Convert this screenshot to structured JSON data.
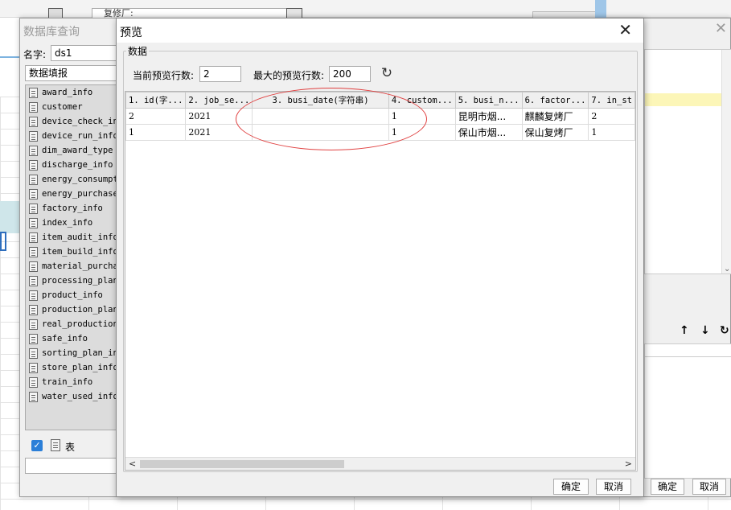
{
  "background": {
    "field_text": "复修厂:"
  },
  "db_dialog": {
    "title": "数据库查询",
    "name_label": "名字:",
    "name_value": "ds1",
    "combo_value": "数据填报",
    "tables": [
      "award_info",
      "customer",
      "device_check_info",
      "device_run_info",
      "dim_award_type",
      "discharge_info",
      "energy_consumption",
      "energy_purchase_",
      "factory_info",
      "index_info",
      "item_audit_info",
      "item_build_info",
      "material_purchase",
      "processing_plan_",
      "product_info",
      "production_plan_",
      "real_production_",
      "safe_info",
      "sorting_plan_info",
      "store_plan_info",
      "train_info",
      "water_used_info"
    ],
    "table_checkbox_label": "表",
    "ok_label": "确定",
    "cancel_label": "取消",
    "arrow_up": "↑",
    "arrow_down": "↓",
    "refresh": "↻"
  },
  "preview": {
    "title": "预览",
    "close": "✕",
    "group_label": "数据",
    "current_rows_label": "当前预览行数:",
    "current_rows_value": "2",
    "max_rows_label": "最大的预览行数:",
    "max_rows_value": "200",
    "refresh_icon": "↻",
    "columns": [
      "1. id(字...",
      "2. job_se...",
      "3. busi_date(字符串)",
      "4. custom...",
      "5. busi_n...",
      "6. factor...",
      "7. in_st"
    ],
    "rows": [
      [
        "2",
        "2021",
        "",
        "1",
        "昆明市烟...",
        "麒麟复烤厂",
        "2"
      ],
      [
        "1",
        "2021",
        "",
        "1",
        "保山市烟...",
        "保山复烤厂",
        "1"
      ]
    ],
    "scroll_left": "<",
    "scroll_right": ">",
    "ok_label": "确定",
    "cancel_label": "取消"
  },
  "colors": {
    "annotation": "#e04040",
    "checkbox": "#2b7fd8"
  }
}
